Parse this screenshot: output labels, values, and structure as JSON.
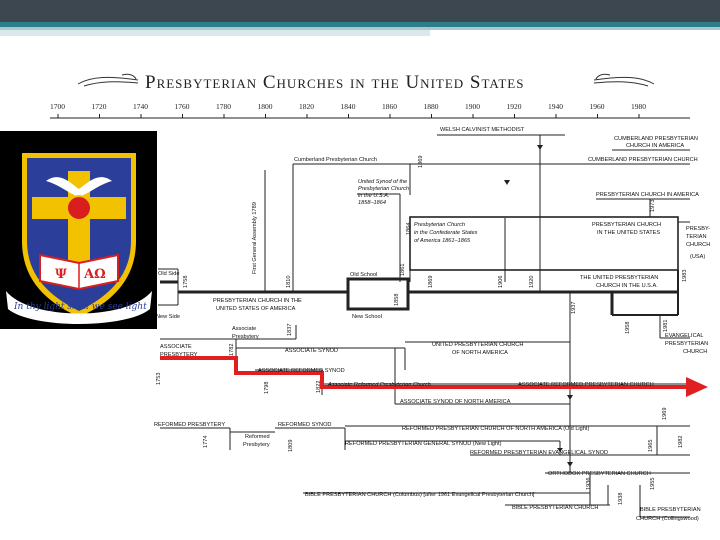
{
  "title": "Presbyterian Churches in the United States",
  "axis_years": [
    "1700",
    "1720",
    "1740",
    "1760",
    "1780",
    "1800",
    "1820",
    "1840",
    "1860",
    "1880",
    "1900",
    "1920",
    "1940",
    "1960",
    "1980"
  ],
  "crest_motto": "In thy light shall we see light",
  "crest_letters": "ΑΩ",
  "labels": {
    "welsh": "WELSH CALVINIST METHODIST",
    "cumberland_america_1": "CUMBERLAND PRESBYTERIAN",
    "cumberland_america_2": "CHURCH IN AMERICA",
    "cumberland_church": "Cumberland Presbyterian Church",
    "cumberland_church_caps": "CUMBERLAND PRESBYTERIAN CHURCH",
    "pca": "PRESBYTERIAN CHURCH IN AMERICA",
    "united_synod_1": "United Synod of the",
    "united_synod_2": "Presbyterian Church",
    "united_synod_3": "in the U.S.A.",
    "united_synod_4": "1858–1864",
    "confederate_1": "Presbyterian Church",
    "confederate_2": "in the Confederate States",
    "confederate_3": "of America 1861–1865",
    "pcus_1": "PRESBYTERIAN CHURCH",
    "pcus_2": "IN THE UNITED STATES",
    "old_side": "Old Side",
    "new_side": "New Side",
    "old_school": "Old School",
    "new_school": "New School",
    "pcusa_1": "PRESBYTERIAN CHURCH IN THE",
    "pcusa_2": "UNITED STATES OF AMERICA",
    "upcusa_1": "THE UNITED PRESBYTERIAN",
    "upcusa_2": "CHURCH IN THE U.S.A.",
    "pcusa_right_1": "PRESBY-",
    "pcusa_right_2": "TERIAN",
    "pcusa_right_3": "CHURCH",
    "pcusa_right_4": "(USA)",
    "assoc_presbytery_1": "Associate",
    "assoc_presbytery_2": "Presbytery",
    "assoc_presbytery_caps_1": "ASSOCIATE",
    "assoc_presbytery_caps_2": "PRESBYTERY",
    "associate_synod": "ASSOCIATE SYNOD",
    "associate_reformed_synod": "ASSOCIATE REFORMED SYNOD",
    "assoc_ref_pres_church": "Associate Reformed Presbyterian Church",
    "assoc_ref_pres_church_caps": "ASSOCIATE REFORMED PRESBYTERIAN CHURCH",
    "upcna_1": "UNITED PRESBYTERIAN CHURCH",
    "upcna_2": "OF NORTH AMERICA",
    "assoc_synod_na": "ASSOCIATE SYNOD OF NORTH AMERICA",
    "epc_1": "EVANGELICAL",
    "epc_2": "PRESBYTERIAN",
    "epc_3": "CHURCH",
    "reformed_presbytery": "REFORMED PRESBYTERY",
    "reformed_presbytery_small_1": "Reformed",
    "reformed_presbytery_small_2": "Presbytery",
    "reformed_synod": "REFORMED SYNOD",
    "rpcna": "REFORMED PRESBYTERIAN CHURCH OF NORTH AMERICA (Old Light)",
    "rpgs": "REFORMED PRESBYTERIAN GENERAL SYNOD (New Light)",
    "rpes": "REFORMED PRESBYTERIAN EVANGELICAL SYNOD",
    "opc": "ORTHODOX PRESBYTERIAN CHURCH",
    "bpc_columbus": "BIBLE PRESBYTERIAN CHURCH (Columbus) [after 1961 Evangelical Presbyterian Church]",
    "bpc": "BIBLE PRESBYTERIAN CHURCH",
    "bpc_coll_1": "BIBLE PRESBYTERIAN",
    "bpc_coll_2": "CHURCH (Collingswood)",
    "first_ga": "First General Assembly 1789"
  },
  "year_marks": {
    "y1758": "1758",
    "y1810": "1810",
    "y1869": "1869",
    "y1864": "1864",
    "y1861": "1861",
    "y1858": "1858",
    "y1906": "1906",
    "y1920": "1920",
    "y1983": "1983",
    "y1973": "1973",
    "y1958": "1958",
    "y1981": "1981",
    "y1937": "1937",
    "y1753": "1753",
    "y1782": "1782",
    "y1798": "1798",
    "y1822": "1822",
    "y1774": "1774",
    "y1809": "1809",
    "y1956": "1956",
    "y1969": "1969",
    "y1965": "1965",
    "y1982": "1982",
    "y1936": "1936",
    "y1938": "1938",
    "y1955": "1955"
  },
  "colors": {
    "highlight": "#e02020",
    "line": "#222222",
    "header": "#3d4750",
    "accent": "#2d7e8a"
  }
}
